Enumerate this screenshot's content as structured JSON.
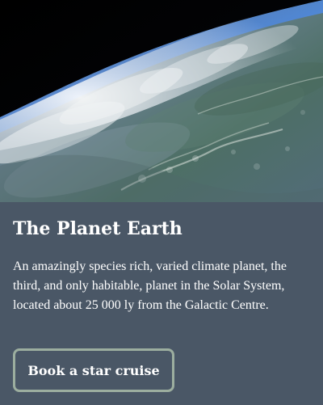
{
  "card": {
    "image_alt": "Earth seen from space",
    "title": "The Planet Earth",
    "description": "An amazingly species rich, varied climate planet, the third, and only habitable, planet in the Solar System, located about 25 000 ly from the Galactic Centre.",
    "button_label": "Book a star cruise"
  },
  "colors": {
    "card_background": "#4a5766",
    "button_border": "#9cae9f",
    "text": "#ffffff"
  }
}
